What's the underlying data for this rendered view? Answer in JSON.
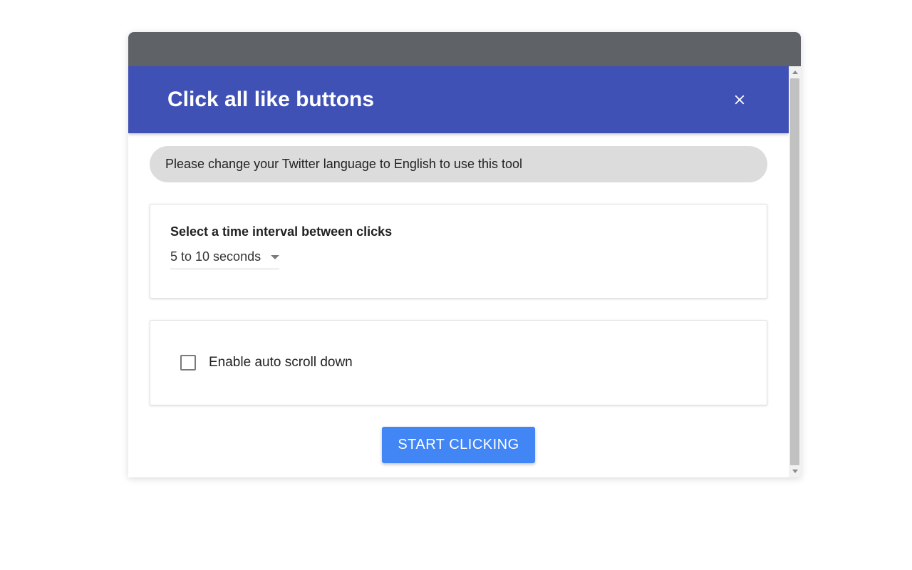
{
  "header": {
    "title": "Click all like buttons"
  },
  "notice": {
    "text": "Please change your Twitter language to English to use this tool"
  },
  "interval": {
    "label": "Select a time interval between clicks",
    "selected": "5 to 10 seconds"
  },
  "autoscroll": {
    "label": "Enable auto scroll down",
    "checked": false
  },
  "action": {
    "start_label": "START CLICKING"
  }
}
